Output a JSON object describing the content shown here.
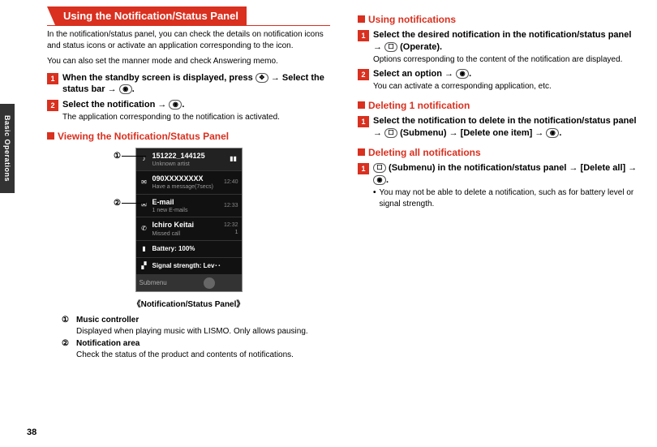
{
  "page_number": "38",
  "side_tab": "Basic Operations",
  "left": {
    "tab_title": "Using the Notification/Status Panel",
    "intro1": "In the notification/status panel, you can check the details on notification icons and status icons or activate an application corresponding to the icon.",
    "intro2": "You can also set the manner mode and check Answering memo.",
    "step1": {
      "num": "1",
      "head": "When the standby screen is displayed, press ",
      "key1": "✥",
      "mid": " → Select the status bar → ",
      "key2": "◉",
      "tail": "."
    },
    "step2": {
      "num": "2",
      "head": "Select the notification → ",
      "key": "◉",
      "tail": ".",
      "sub": "The application corresponding to the notification is activated."
    },
    "sub_view": "Viewing the Notification/Status Panel",
    "phone": {
      "music_title": "151222_144125",
      "music_artist": "Unknown artist",
      "r1_title": "090XXXXXXXX",
      "r1_sub": "Have a message(7secs)",
      "r1_time": "12:40",
      "r2_title": "E-mail",
      "r2_sub": "1 new E-mails",
      "r2_time": "12:33",
      "r3_title": "Ichiro Keitai",
      "r3_sub": "Missed call",
      "r3_time": "12:32",
      "r3_count": "1",
      "battery": "Battery: 100%",
      "signal": "Signal strength: Lev･･",
      "submenu": "Submenu"
    },
    "caption": "《Notification/Status Panel》",
    "c1_label": "①",
    "c2_label": "②",
    "leg1_num": "①",
    "leg1_title": "Music controller",
    "leg1_body": "Displayed when playing music with LISMO. Only allows pausing.",
    "leg2_num": "②",
    "leg2_title": "Notification area",
    "leg2_body": "Check the status of the product and contents of notifications."
  },
  "right": {
    "h_use": "Using notifications",
    "u1": {
      "num": "1",
      "head": "Select the desired notification in the notification/status panel → ",
      "key": "☐",
      "keylabel": " (Operate).",
      "sub": "Options corresponding to the content of the notification are displayed."
    },
    "u2": {
      "num": "2",
      "head": "Select an option → ",
      "key": "◉",
      "tail": ".",
      "sub": "You can activate a corresponding application, etc."
    },
    "h_del1": "Deleting 1 notification",
    "d1": {
      "num": "1",
      "head": "Select the notification to delete in the notification/status panel → ",
      "key1": "☐",
      "key1label": " (Submenu) → [Delete one item] → ",
      "key2": "◉",
      "tail": "."
    },
    "h_delall": "Deleting all notifications",
    "da": {
      "num": "1",
      "head": "",
      "key1": "☐",
      "key1label": " (Submenu) in the notification/status panel → [Delete all] → ",
      "key2": "◉",
      "tail": ".",
      "note": "You may not be able to delete a notification, such as for battery level or signal strength."
    }
  }
}
